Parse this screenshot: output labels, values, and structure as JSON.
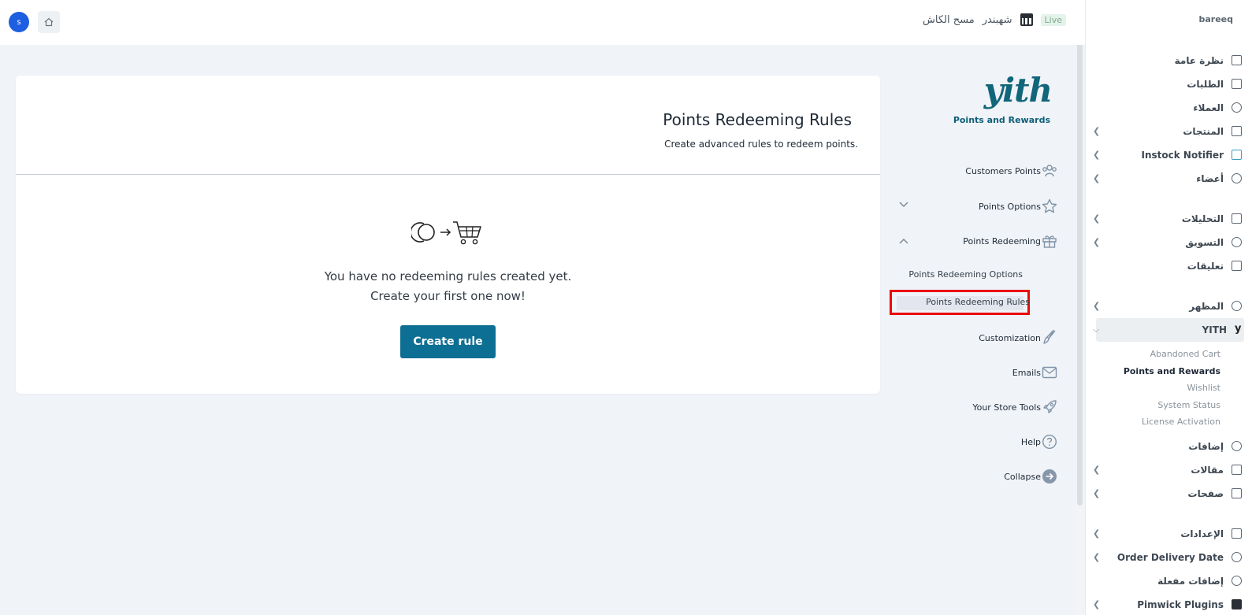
{
  "topbar": {
    "avatar_letter": "s",
    "clear_cache": "مسح الكاش",
    "store_name": "شهبندر",
    "live": "Live"
  },
  "admin": {
    "brand": "bareeq",
    "items": [
      {
        "label": "نظرة عامة",
        "icon": "chart-icon",
        "chevron": false
      },
      {
        "label": "الطلبات",
        "icon": "cart-icon",
        "chevron": false
      },
      {
        "label": "العملاء",
        "icon": "users-icon",
        "chevron": false
      },
      {
        "label": "المنتجات",
        "icon": "box-icon",
        "chevron": true
      },
      {
        "label": "Instock Notifier",
        "icon": "bell-icon",
        "chevron": true
      },
      {
        "label": "أعضاء",
        "icon": "users-icon",
        "chevron": true
      }
    ],
    "items2": [
      {
        "label": "التحليلات",
        "icon": "chart-icon",
        "chevron": true
      },
      {
        "label": "التسويق",
        "icon": "megaphone-icon",
        "chevron": true
      },
      {
        "label": "تعليقات",
        "icon": "comment-icon",
        "chevron": false
      }
    ],
    "appearance": "المظهر",
    "yith": "YITH",
    "yith_sub": [
      "Abandoned Cart",
      "Points and Rewards",
      "Wishlist",
      "System Status",
      "License Activation"
    ],
    "items3": [
      {
        "label": "إضافات",
        "icon": "puzzle-icon",
        "chevron": false
      },
      {
        "label": "مقالات",
        "icon": "document-icon",
        "chevron": true
      },
      {
        "label": "صفحات",
        "icon": "page-icon",
        "chevron": true
      }
    ],
    "items4": [
      {
        "label": "الإعدادات",
        "icon": "sliders-icon",
        "chevron": true
      },
      {
        "label": "Order Delivery Date",
        "icon": "gear-icon",
        "chevron": true
      },
      {
        "label": "إضافات مفعلة",
        "icon": "puzzle-icon",
        "chevron": false
      },
      {
        "label": "Pimwick Plugins",
        "icon": "pw-icon",
        "chevron": true
      }
    ]
  },
  "plugin": {
    "logo": "yith",
    "title": "Points and Rewards",
    "menu": {
      "customers_points": "Customers Points",
      "points_options": "Points Options",
      "points_redeeming": "Points Redeeming",
      "redeeming_options": "Points Redeeming Options",
      "redeeming_rules": "Points Redeeming Rules",
      "customization": "Customization",
      "emails": "Emails",
      "store_tools": "Your Store Tools",
      "help": "Help",
      "collapse": "Collapse"
    }
  },
  "main": {
    "title": "Points Redeeming Rules",
    "subtitle": "Create advanced rules to redeem points.",
    "empty_line1": "You have no redeeming rules created yet.",
    "empty_line2": "Create your first one now!",
    "create_button": "Create rule"
  },
  "colors": {
    "accent": "#0e6f94",
    "highlight_border": "#ea0a0a",
    "avatar": "#1d5fe0"
  }
}
